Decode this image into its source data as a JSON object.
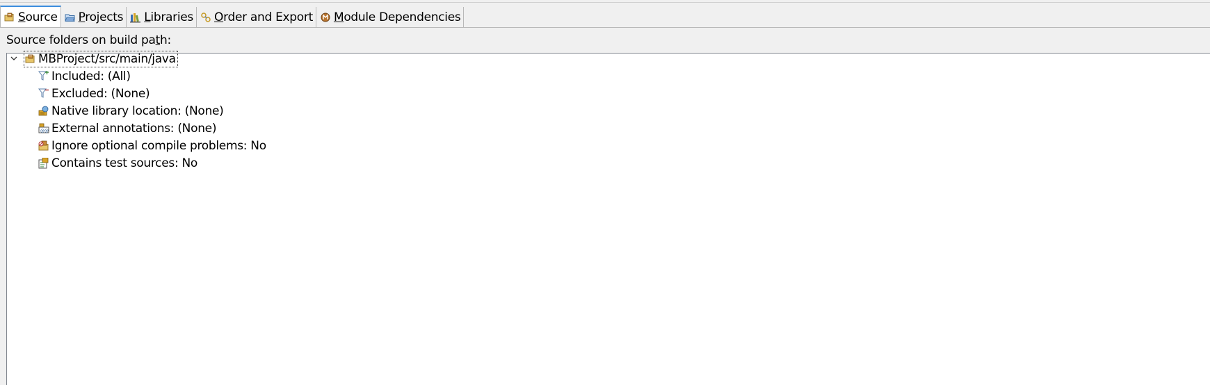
{
  "tabs": [
    {
      "label": "Source",
      "mnemonic": "S",
      "rest": "ource",
      "icon": "source-folder-icon",
      "active": true
    },
    {
      "label": "Projects",
      "mnemonic": "P",
      "rest": "rojects",
      "icon": "projects-folder-icon",
      "active": false
    },
    {
      "label": "Libraries",
      "mnemonic": "L",
      "rest": "ibraries",
      "icon": "libraries-icon",
      "active": false
    },
    {
      "label": "Order and Export",
      "mnemonic": "O",
      "rest": "rder and Export",
      "icon": "order-export-icon",
      "active": false
    },
    {
      "label": "Module Dependencies",
      "mnemonic": "M",
      "rest": "odule Dependencies",
      "icon": "module-icon",
      "active": false
    }
  ],
  "section_label": {
    "before": "Source folders on build pa",
    "mnemonic": "t",
    "after": "h:"
  },
  "tree": {
    "root": {
      "label": "MBProject/src/main/java",
      "icon": "source-folder-icon",
      "expanded": true
    },
    "children": [
      {
        "label": "Included: (All)",
        "icon": "inclusion-filter-icon"
      },
      {
        "label": "Excluded: (None)",
        "icon": "exclusion-filter-icon"
      },
      {
        "label": "Native library location: (None)",
        "icon": "native-library-icon"
      },
      {
        "label": "External annotations: (None)",
        "icon": "external-annotations-icon"
      },
      {
        "label": "Ignore optional compile problems: No",
        "icon": "ignore-problems-icon"
      },
      {
        "label": "Contains test sources: No",
        "icon": "test-sources-icon"
      }
    ]
  },
  "colors": {
    "accent": "#3c8dde",
    "panel_bg": "#ffffff",
    "window_bg": "#f0f0f0"
  }
}
